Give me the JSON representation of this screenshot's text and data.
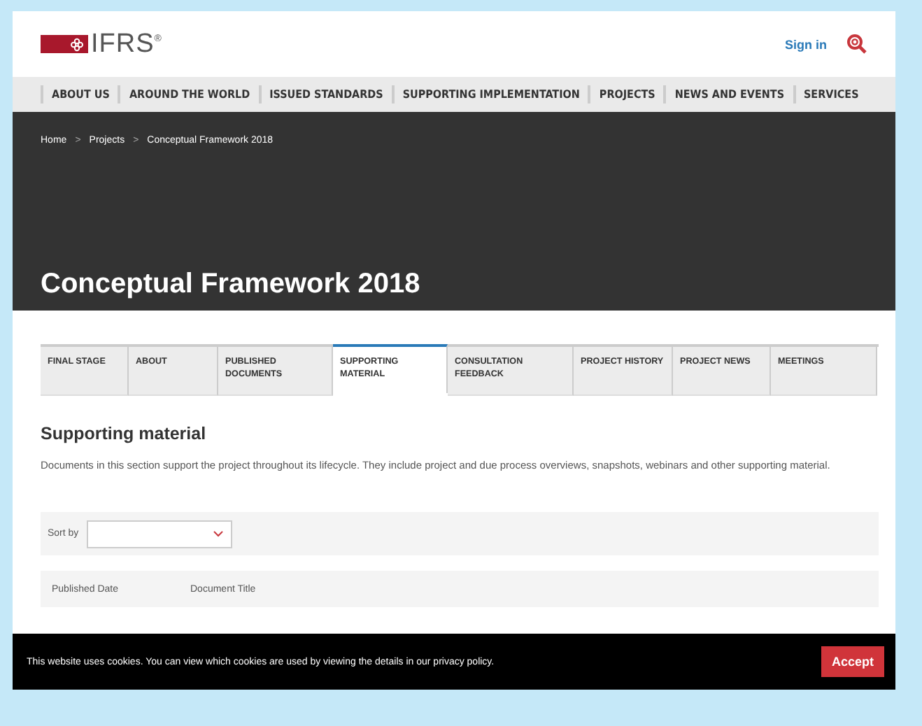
{
  "header": {
    "logo": "IFRS$^{®}$",
    "sign_in": "Sign in"
  },
  "nav": [
    "ABOUT US",
    "AROUND THE WORLD",
    "ISSUED STANDARDS",
    "SUPPORTING IMPLEMENTATION",
    "PROJECTS",
    "NEWS AND EVENTS",
    "SERVICES"
  ],
  "breadcrumb": {
    "separator": ">",
    "items": [
      "Home",
      "Projects",
      "Conceptual Framework 2018"
    ]
  },
  "hero": {
    "title": "Conceptual Framework 2018"
  },
  "tabs": [
    {
      "label": "FINAL STAGE",
      "selected": false
    },
    {
      "label": "ABOUT",
      "selected": false
    },
    {
      "label": "PUBLISHED DOCUMENTS",
      "selected": false
    },
    {
      "label": "SUPPORTING MATERIAL",
      "selected": true
    },
    {
      "label": "CONSULTATION FEEDBACK",
      "selected": false
    },
    {
      "label": "PROJECT HISTORY",
      "selected": false
    },
    {
      "label": "PROJECT NEWS",
      "selected": false
    },
    {
      "label": "MEETINGS",
      "selected": false
    }
  ],
  "section": {
    "heading": "Supporting material",
    "description": "Documents in this section support the project throughout its lifecycle. They include project and due process overviews, snapshots, webinars and other supporting material."
  },
  "sort": {
    "label": "Sort by"
  },
  "table": {
    "columns": [
      "Published Date",
      "Document Title"
    ]
  },
  "cookie_bar": {
    "text": "This website uses cookies. You can view which cookies are used by viewing the details in our ",
    "link": "privacy policy",
    "after": ".",
    "button": "Accept"
  }
}
